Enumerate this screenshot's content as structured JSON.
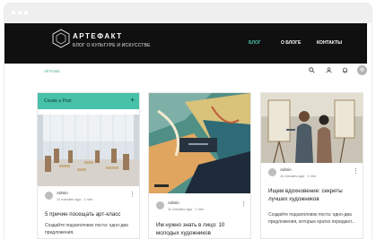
{
  "header": {
    "logo_title": "АРТЕФАКТ",
    "logo_subtitle": "БЛОГ О КУЛЬТУРЕ И ИСКУССТВЕ",
    "nav": [
      {
        "label": "БЛОГ",
        "active": true
      },
      {
        "label": "О БЛОГЕ",
        "active": false
      },
      {
        "label": "КОНТАКТЫ",
        "active": false
      }
    ]
  },
  "toolbar": {
    "all_posts": "All Posts",
    "icons": [
      "search-icon",
      "user-icon",
      "bell-icon",
      "avatar"
    ]
  },
  "create_post": {
    "label": "Create a Post",
    "plus": "+"
  },
  "posts": [
    {
      "author": "Admin",
      "meta": "11 minutes ago · 1 min",
      "title": "5 причин посещать арт-класс",
      "excerpt": "Создайте подзаголовок поста: одно-два предложения,"
    },
    {
      "author": "Admin",
      "meta": "11 minutes ago · 1 min",
      "title": "Им нужно знать в лицо: 10 молодых художников",
      "excerpt": ""
    },
    {
      "author": "Admin",
      "meta": "11 minutes ago · 1 min",
      "title": "Ищем вдохновение: секреты лучших художников",
      "excerpt": "Создайте подзаголовок поста: одно-два предложения, которые кратко передают..."
    }
  ],
  "colors": {
    "accent": "#47c1a8",
    "header_bg": "#101010"
  }
}
